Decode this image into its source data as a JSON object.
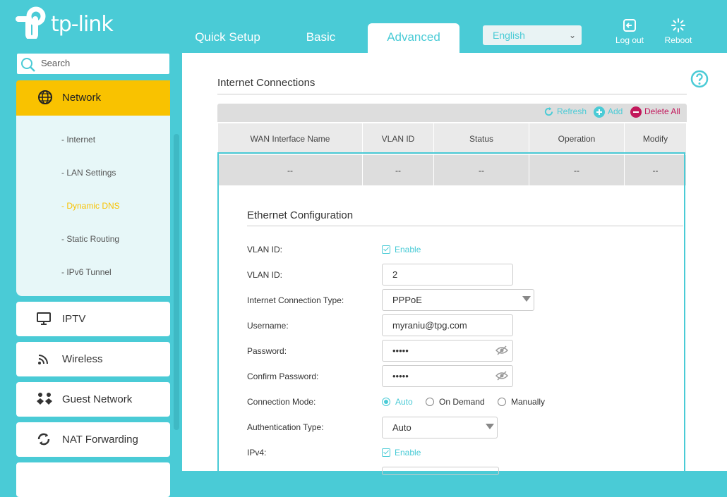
{
  "brand": {
    "logo_text": "tp-link"
  },
  "header": {
    "tabs": [
      {
        "label": "Quick Setup",
        "active": false
      },
      {
        "label": "Basic",
        "active": false
      },
      {
        "label": "Advanced",
        "active": true
      }
    ],
    "language": "English",
    "logout_label": "Log out",
    "reboot_label": "Reboot"
  },
  "sidebar": {
    "search_placeholder": "Search",
    "network": {
      "label": "Network",
      "subitems": [
        {
          "label": "- Internet"
        },
        {
          "label": "- LAN Settings"
        },
        {
          "label": "- Dynamic DNS",
          "active": true
        },
        {
          "label": "- Static Routing"
        },
        {
          "label": "- IPv6 Tunnel"
        }
      ]
    },
    "items": [
      {
        "label": "IPTV",
        "icon": "monitor-icon"
      },
      {
        "label": "Wireless",
        "icon": "wifi-icon"
      },
      {
        "label": "Guest Network",
        "icon": "guest-network-icon"
      },
      {
        "label": "NAT Forwarding",
        "icon": "nat-forwarding-icon"
      }
    ]
  },
  "main": {
    "section_title": "Internet Connections",
    "toolbar": {
      "refresh": "Refresh",
      "add": "Add",
      "delete_all": "Delete All"
    },
    "table": {
      "headers": [
        "WAN Interface Name",
        "VLAN ID",
        "Status",
        "Operation",
        "Modify"
      ],
      "row": [
        "--",
        "--",
        "--",
        "--",
        "--"
      ]
    },
    "ethernet": {
      "title": "Ethernet Configuration",
      "vlan_enable_label": "VLAN ID:",
      "vlan_enable_text": "Enable",
      "vlan_id_label": "VLAN ID:",
      "vlan_id_value": "2",
      "conn_type_label": "Internet Connection Type:",
      "conn_type_value": "PPPoE",
      "username_label": "Username:",
      "username_value": "myraniu@tpg.com",
      "password_label": "Password:",
      "password_value": "•••••",
      "confirm_label": "Confirm Password:",
      "confirm_value": "•••••",
      "conn_mode_label": "Connection Mode:",
      "conn_modes": [
        {
          "label": "Auto",
          "selected": true
        },
        {
          "label": "On Demand",
          "selected": false
        },
        {
          "label": "Manually",
          "selected": false
        }
      ],
      "auth_label": "Authentication Type:",
      "auth_value": "Auto",
      "ipv4_label": "IPv4:",
      "ipv4_enable_text": "Enable"
    }
  },
  "colors": {
    "accent": "#4acbd6",
    "active_nav": "#f9c200",
    "delete": "#c2185b"
  }
}
